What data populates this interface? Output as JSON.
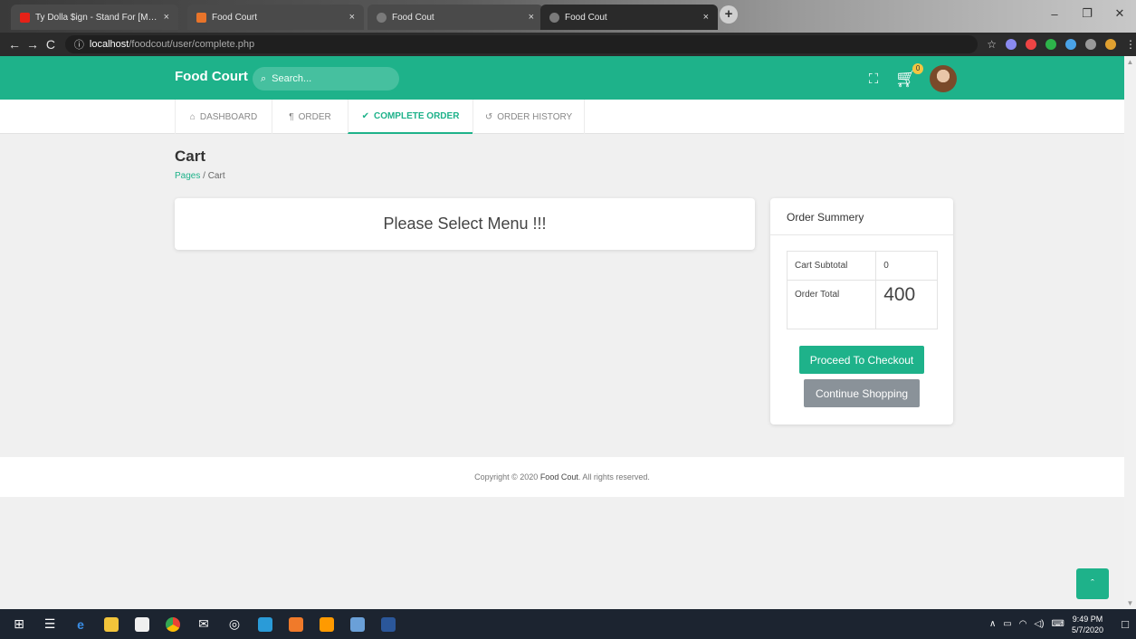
{
  "browser": {
    "tabs": [
      {
        "title": "Ty Dolla $ign - Stand For [M…",
        "favicon_color": "#e62117"
      },
      {
        "title": "Food Court",
        "favicon_color": "#e8742a"
      },
      {
        "title": "Food Cout",
        "favicon_color": "#7a7a7a"
      },
      {
        "title": "Food Cout",
        "favicon_color": "#7a7a7a"
      }
    ],
    "close_symbol": "×",
    "new_tab_symbol": "+",
    "window_buttons": [
      "–",
      "❐",
      "✕"
    ],
    "url_host": "localhost",
    "url_path": "/foodcout/user/complete.php",
    "nav_symbols": {
      "back": "←",
      "forward": "→",
      "reload": "C",
      "info": "ⓘ",
      "star": "☆",
      "menu": "⋮"
    }
  },
  "header": {
    "brand": "Food Court",
    "search_placeholder": "Search...",
    "search_icon": "search-icon",
    "fullscreen_icon": "fullscreen-icon",
    "cart_icon": "cart-icon",
    "cart_badge": "0",
    "accent_color": "#1eb28a"
  },
  "nav": {
    "tabs": [
      {
        "label": "DASHBOARD",
        "icon": "⌂",
        "active": false
      },
      {
        "label": "ORDER",
        "icon": "¶",
        "active": false
      },
      {
        "label": "COMPLETE ORDER",
        "icon": "✔",
        "active": true
      },
      {
        "label": "ORDER HISTORY",
        "icon": "↺",
        "active": false
      }
    ]
  },
  "page": {
    "title": "Cart",
    "breadcrumb": {
      "link": "Pages",
      "separator": "/",
      "current": "Cart"
    },
    "empty_message": "Please Select Menu !!!"
  },
  "summary": {
    "heading": "Order Summery",
    "rows": [
      {
        "label": "Cart Subtotal",
        "value": "0"
      },
      {
        "label": "Order Total",
        "value": "400"
      }
    ],
    "checkout_label": "Proceed To Checkout",
    "continue_label": "Continue Shopping"
  },
  "footer": {
    "text_before": "Copyright © 2020 ",
    "brand": "Food Cout",
    "text_after": ". All rights reserved."
  },
  "scroll_top_symbol": "ˆ",
  "taskbar": {
    "time": "9:49 PM",
    "date": "5/7/2020",
    "tray_symbols": [
      "∧",
      "▭",
      "◠",
      "◁)",
      "⌨"
    ]
  }
}
